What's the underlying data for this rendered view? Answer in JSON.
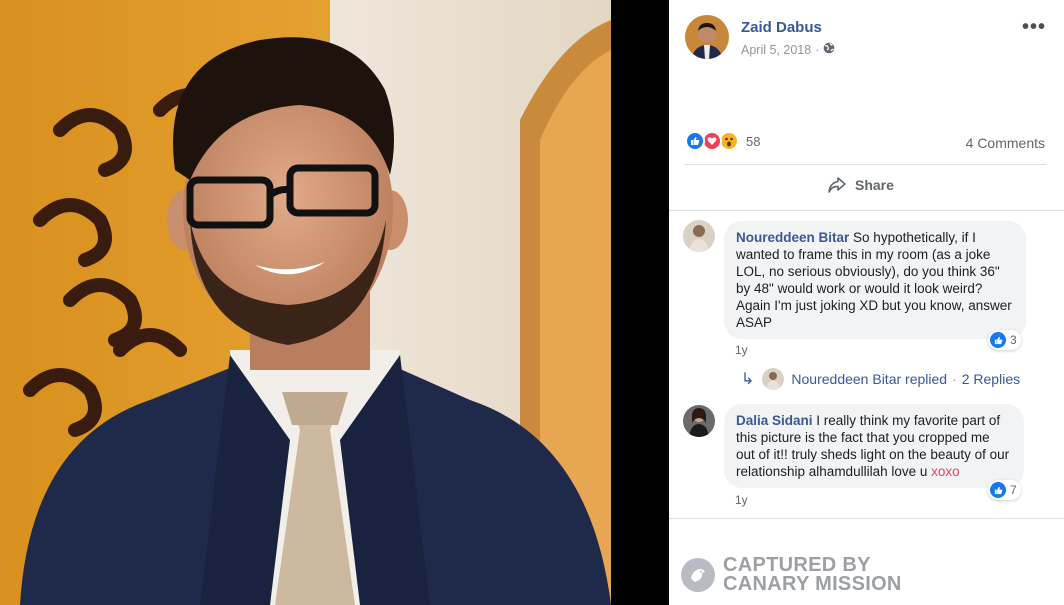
{
  "post": {
    "author": "Zaid Dabus",
    "date": "April 5, 2018",
    "privacy_icon": "globe-icon",
    "more_label": "•••",
    "reaction_count": "58",
    "reactions": [
      "like",
      "love",
      "wow"
    ],
    "comments_count": "4 Comments",
    "share_label": "Share"
  },
  "comments": [
    {
      "name": "Noureddeen Bitar",
      "text": "So hypothetically, if I wanted to frame this in my room (as a joke LOL, no serious obviously), do you think 36\" by 48\" would work or would it look weird? Again I'm just joking XD but you know, answer ASAP",
      "likes": "3",
      "age": "1y"
    },
    {
      "name": "Dalia Sidani",
      "text": "I really think my favorite part of this picture is the fact that you cropped me out of it!! truly sheds light on the beauty of our relationship alhamdullilah love u",
      "highlight": "xoxo",
      "likes": "7",
      "age": "1y"
    }
  ],
  "reply_summary": {
    "name": "Noureddeen Bitar replied",
    "separator": "·",
    "count": "2 Replies"
  },
  "watermark": {
    "line1": "CAPTURED BY",
    "line2": "CANARY MISSION"
  },
  "colors": {
    "link_blue": "#385898",
    "like_blue": "#1877f2",
    "love_red": "#f33e58",
    "wow_yellow": "#f7b125",
    "xoxo_red": "#e4405f"
  }
}
